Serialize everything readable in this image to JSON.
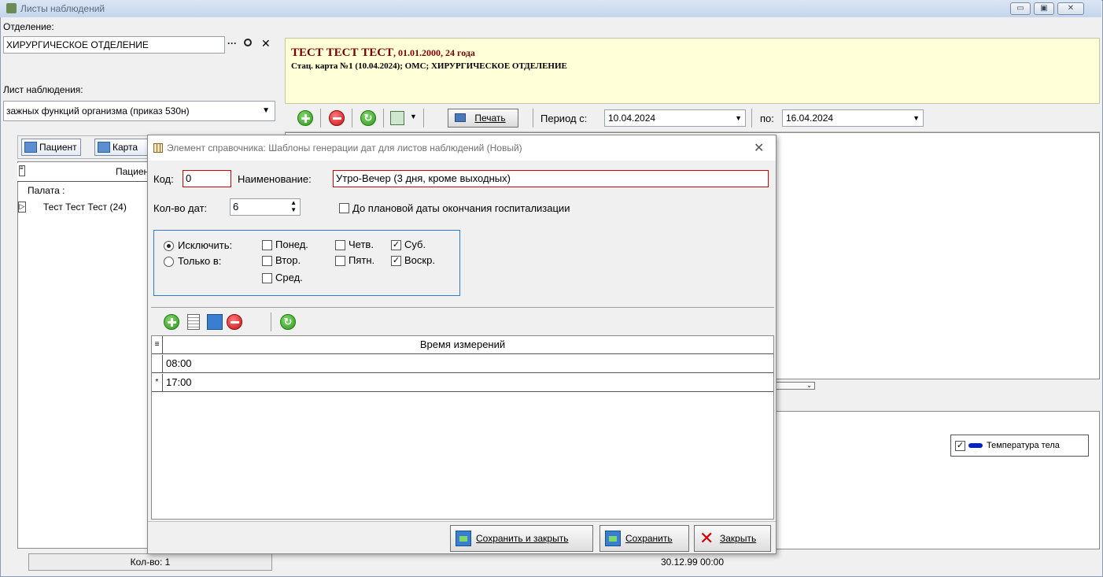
{
  "window": {
    "title": "Листы наблюдений",
    "controls": [
      "▭",
      "▣",
      "✕"
    ]
  },
  "left": {
    "department_label": "Отделение:",
    "department_value": "ХИРУРГИЧЕСКОЕ ОТДЕЛЕНИЕ",
    "department_icons": [
      "···",
      "🔍",
      "✕"
    ],
    "sheet_label": "Лист наблюдения:",
    "sheet_value": "зажных функций организма (приказ 530н)",
    "tabs": [
      "Пациент",
      "Карта"
    ],
    "grid_header": "Пациент",
    "group_label": "Палата :",
    "patient_row": "Тест Тест Тест (24)",
    "count": "Кол-во: 1"
  },
  "banner": {
    "name": "ТЕСТ ТЕСТ ТЕСТ",
    "details": ", 01.01.2000, 24 года",
    "line2": "Стац. карта №1 (10.04.2024); ОМС; ХИРУРГИЧЕСКОЕ ОТДЕЛЕНИЕ"
  },
  "toolbar": {
    "print_label": "Печать",
    "period_from_label": "Период с:",
    "period_from": "10.04.2024",
    "period_to_label": "по:",
    "period_to": "16.04.2024"
  },
  "legend": {
    "label": "Температура тела",
    "checked": "✓"
  },
  "bottom": {
    "date": "30.12.99 00:00",
    "collapse": "⌄"
  },
  "dialog": {
    "title": "Элемент справочника: Шаблоны генерации дат для листов наблюдений (Новый)",
    "code_label": "Код:",
    "code_value": "0",
    "name_label": "Наименование:",
    "name_value": "Утро-Вечер (3 дня, кроме выходных)",
    "dates_count_label": "Кол-во дат:",
    "dates_count_value": "6",
    "until_label": "До плановой даты окончания госпитализации",
    "mode_exclude": "Исключить:",
    "mode_only": "Только в:",
    "days": {
      "mon": "Понед.",
      "tue": "Втор.",
      "wed": "Сред.",
      "thu": "Четв.",
      "fri": "Пятн.",
      "sat": "Суб.",
      "sun": "Воскр."
    },
    "check_mark": "✓",
    "grid_header": "Время измерений",
    "times": [
      "08:00",
      "17:00"
    ],
    "new_row_marker": "*",
    "btn_save_close": "Сохранить и закрыть",
    "btn_save": "Сохранить",
    "btn_close": "Закрыть",
    "close_x": "✕"
  }
}
